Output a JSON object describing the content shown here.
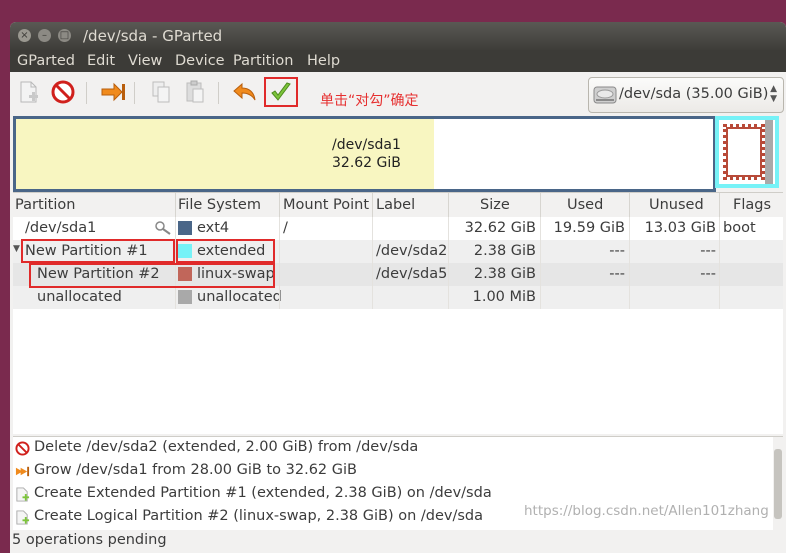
{
  "window": {
    "title": "/dev/sda - GParted",
    "buttons": {
      "close": "×",
      "minimize": "–",
      "maximize": "□"
    }
  },
  "menu": [
    "GParted",
    "Edit",
    "View",
    "Device",
    "Partition",
    "Help"
  ],
  "toolbar": {
    "annotation": "单击“对勾”确定",
    "device": "/dev/sda   (35.00 GiB)"
  },
  "diskmap": {
    "sda1_name": "/dev/sda1",
    "sda1_size": "32.62 GiB"
  },
  "table": {
    "headers": [
      "Partition",
      "File System",
      "Mount Point",
      "Label",
      "Size",
      "Used",
      "Unused",
      "Flags"
    ],
    "rows": [
      {
        "partition": "/dev/sda1",
        "fs": "ext4",
        "mount": "/",
        "label": "",
        "size": "32.62 GiB",
        "used": "19.59 GiB",
        "unused": "13.03 GiB",
        "flags": "boot"
      },
      {
        "partition": "New Partition #1",
        "fs": "extended",
        "mount": "",
        "label": "/dev/sda2",
        "size": "2.38 GiB",
        "used": "---",
        "unused": "---",
        "flags": ""
      },
      {
        "partition": "New Partition #2",
        "fs": "linux-swap",
        "mount": "",
        "label": "/dev/sda5",
        "size": "2.38 GiB",
        "used": "---",
        "unused": "---",
        "flags": ""
      },
      {
        "partition": "unallocated",
        "fs": "unallocated",
        "mount": "",
        "label": "",
        "size": "1.00 MiB",
        "used": "",
        "unused": "",
        "flags": ""
      }
    ]
  },
  "colors": {
    "ext4": "#4a6688",
    "extended": "#76f2f7",
    "linux_swap": "#c1665a",
    "unallocated": "#a9a9a9",
    "annotation": "#e02a2a"
  },
  "operations": [
    "Delete /dev/sda2 (extended, 2.00 GiB) from /dev/sda",
    "Grow /dev/sda1 from 28.00 GiB to 32.62 GiB",
    "Create Extended Partition #1 (extended, 2.38 GiB) on /dev/sda",
    "Create Logical Partition #2 (linux-swap, 2.38 GiB) on /dev/sda"
  ],
  "status": "5 operations pending",
  "watermark": "https://blog.csdn.net/Allen101zhang"
}
